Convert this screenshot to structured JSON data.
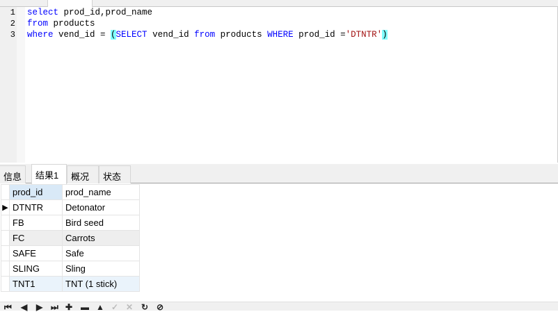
{
  "editor": {
    "line_numbers": [
      "1",
      "2",
      "3"
    ],
    "lines": [
      {
        "kw1": "select",
        "rest": " prod_id,prod_name"
      },
      {
        "kw1": "from",
        "rest": " products"
      },
      {
        "kw1": "where",
        "rest": " vend_id = ",
        "paren_open": "(",
        "kw2": "SELECT",
        "mid1": " vend_id ",
        "kw3": "from",
        "mid2": " products ",
        "kw4": "WHERE",
        "mid3": " prod_id =",
        "str": "'DTNTR'",
        "paren_close": ")"
      }
    ]
  },
  "tabs": [
    "信息",
    "结果1",
    "概况",
    "状态"
  ],
  "active_tab": "结果1",
  "grid": {
    "columns": [
      "prod_id",
      "prod_name"
    ],
    "rows": [
      [
        "DTNTR",
        "Detonator"
      ],
      [
        "FB",
        "Bird seed"
      ],
      [
        "FC",
        "Carrots"
      ],
      [
        "SAFE",
        "Safe"
      ],
      [
        "SLING",
        "Sling"
      ],
      [
        "TNT1",
        "TNT (1 stick)"
      ]
    ],
    "current_row_marker": "▶"
  },
  "toolbar": {
    "first": "⏮",
    "prev": "◀",
    "next": "▶",
    "last": "⏭",
    "add": "✚",
    "delete": "▬",
    "up": "▲",
    "apply": "✓",
    "cancel": "✕",
    "refresh": "↻",
    "stop": "⊘"
  }
}
